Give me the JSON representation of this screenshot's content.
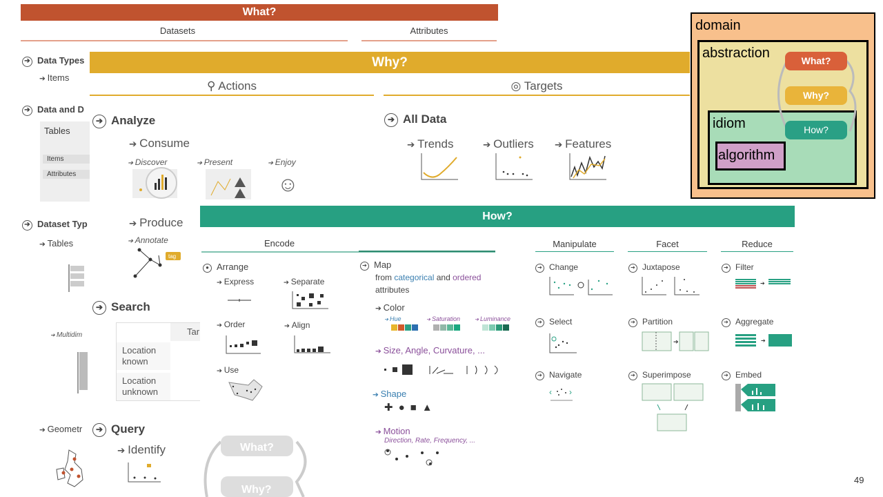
{
  "what": {
    "title": "What?",
    "datasets": "Datasets",
    "attributes": "Attributes",
    "data_types": "Data Types",
    "items": "Items",
    "data_and_d": "Data and D",
    "tables_box": {
      "title": "Tables",
      "items": "Items",
      "attributes": "Attributes"
    },
    "dataset_types": "Dataset Typ",
    "tables": "Tables",
    "multidim": "Multidim",
    "geometry": "Geometr"
  },
  "why": {
    "title": "Why?",
    "actions": "Actions",
    "targets": "Targets",
    "analyze": "Analyze",
    "consume": "Consume",
    "discover": "Discover",
    "present": "Present",
    "enjoy": "Enjoy",
    "produce": "Produce",
    "annotate": "Annotate",
    "tag": "tag",
    "search": "Search",
    "search_table": {
      "header": "Tar",
      "rows": [
        "Location known",
        "Location unknown"
      ]
    },
    "query": "Query",
    "identify": "Identify",
    "all_data": "All Data",
    "trends": "Trends",
    "outliers": "Outliers",
    "features": "Features"
  },
  "how": {
    "title": "How?",
    "encode": "Encode",
    "manipulate": "Manipulate",
    "facet": "Facet",
    "reduce": "Reduce",
    "arrange": "Arrange",
    "express": "Express",
    "separate": "Separate",
    "order": "Order",
    "align": "Align",
    "use": "Use",
    "map": "Map",
    "map_from": "from",
    "categorical": "categorical",
    "and": "and",
    "ordered": "ordered",
    "attributes": "attributes",
    "color": "Color",
    "hue": "Hue",
    "saturation": "Saturation",
    "luminance": "Luminance",
    "size": "Size, Angle, Curvature, ...",
    "shape": "Shape",
    "motion": "Motion",
    "motion_sub": "Direction, Rate, Frequency, ...",
    "change": "Change",
    "select": "Select",
    "navigate": "Navigate",
    "juxtapose": "Juxtapose",
    "partition": "Partition",
    "superimpose": "Superimpose",
    "filter": "Filter",
    "aggregate": "Aggregate",
    "embed": "Embed",
    "ghost_what": "What?",
    "ghost_why": "Why?"
  },
  "model": {
    "domain": "domain",
    "abstraction": "abstraction",
    "idiom": "idiom",
    "algorithm": "algorithm",
    "what": "What?",
    "why": "Why?",
    "how": "How?"
  },
  "colors": {
    "what": "#c0532f",
    "why": "#e0ab2c",
    "how": "#27a082",
    "domain": "#f8c08c",
    "abstraction": "#ede0a0",
    "idiom": "#a8dcb8",
    "algorithm": "#d0a0c8"
  },
  "page_number": "49"
}
